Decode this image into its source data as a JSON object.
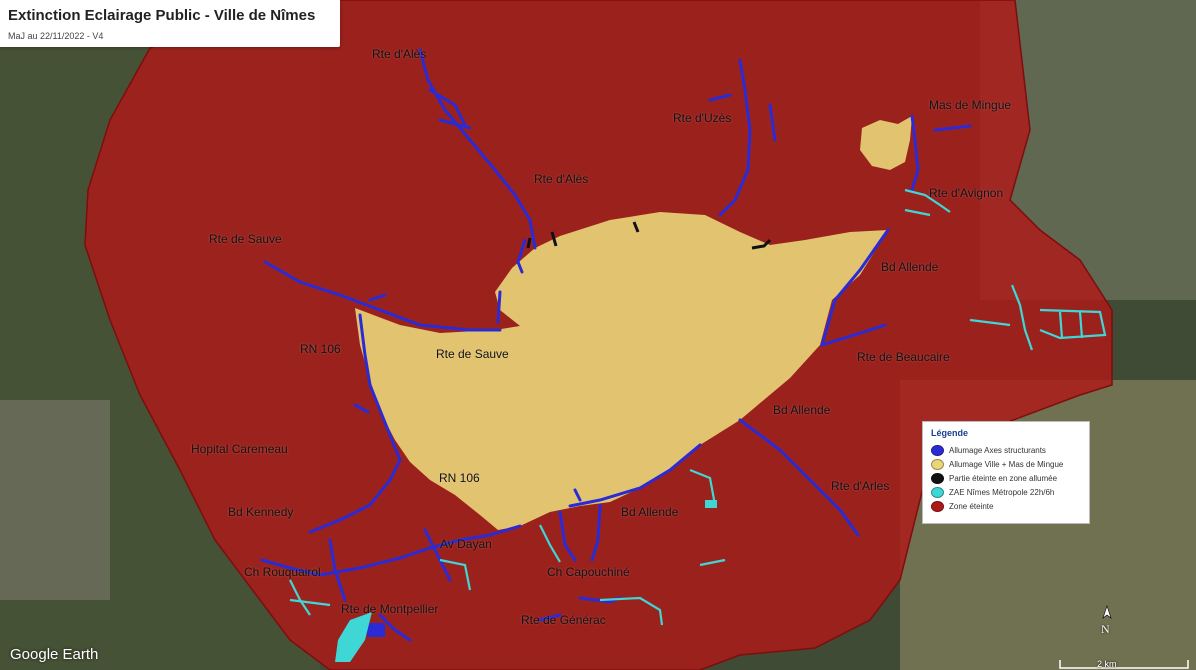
{
  "header": {
    "title": "Extinction Eclairage Public - Ville de Nîmes",
    "subtitle": "MaJ au 22/11/2022 - V4"
  },
  "road_labels": [
    {
      "id": "rte-ales-1",
      "text": "Rte d'Alès"
    },
    {
      "id": "rte-ales-2",
      "text": "Rte d'Alès"
    },
    {
      "id": "rte-uzes",
      "text": "Rte d'Uzès"
    },
    {
      "id": "mas-de-mingue",
      "text": "Mas de Mingue"
    },
    {
      "id": "rte-avignon",
      "text": "Rte d'Avignon"
    },
    {
      "id": "bd-allende-1",
      "text": "Bd Allende"
    },
    {
      "id": "rte-sauve-1",
      "text": "Rte de Sauve"
    },
    {
      "id": "rte-sauve-2",
      "text": "Rte de Sauve"
    },
    {
      "id": "rn106-1",
      "text": "RN 106"
    },
    {
      "id": "rte-beaucaire",
      "text": "Rte de Beaucaire"
    },
    {
      "id": "bd-allende-2",
      "text": "Bd Allende"
    },
    {
      "id": "hopital",
      "text": "Hopital Caremeau"
    },
    {
      "id": "rn106-2",
      "text": "RN 106"
    },
    {
      "id": "rte-arles",
      "text": "Rte d'Arles"
    },
    {
      "id": "bd-kennedy",
      "text": "Bd Kennedy"
    },
    {
      "id": "bd-allende-3",
      "text": "Bd Allende"
    },
    {
      "id": "av-dayan",
      "text": "Av Dayan"
    },
    {
      "id": "ch-rouquairol",
      "text": "Ch Rouquairol"
    },
    {
      "id": "ch-capouchine",
      "text": "Ch Capouchiné"
    },
    {
      "id": "rte-montpellier",
      "text": "Rte de Montpellier"
    },
    {
      "id": "rte-generac",
      "text": "Rte de Générac"
    }
  ],
  "legend": {
    "title": "Légende",
    "items": [
      {
        "label": "Allumage Axes structurants",
        "color": "#2b2bd6"
      },
      {
        "label": "Allumage Ville + Mas de Mingue",
        "color": "#ead57a"
      },
      {
        "label": "Partie éteinte en zone allumée",
        "color": "#111111"
      },
      {
        "label": "ZAE Nîmes Métropole 22h/6h",
        "color": "#3fd6d6"
      },
      {
        "label": "Zone éteinte",
        "color": "#b01818"
      }
    ]
  },
  "footer": {
    "logo": "Google Earth",
    "north": "N",
    "scale": "2 km"
  },
  "colors": {
    "zone_off": "#b01818",
    "zone_lit": "#ead57a",
    "axes": "#2b2bd6",
    "zae": "#3fd6d6",
    "off_in_lit": "#111111"
  }
}
